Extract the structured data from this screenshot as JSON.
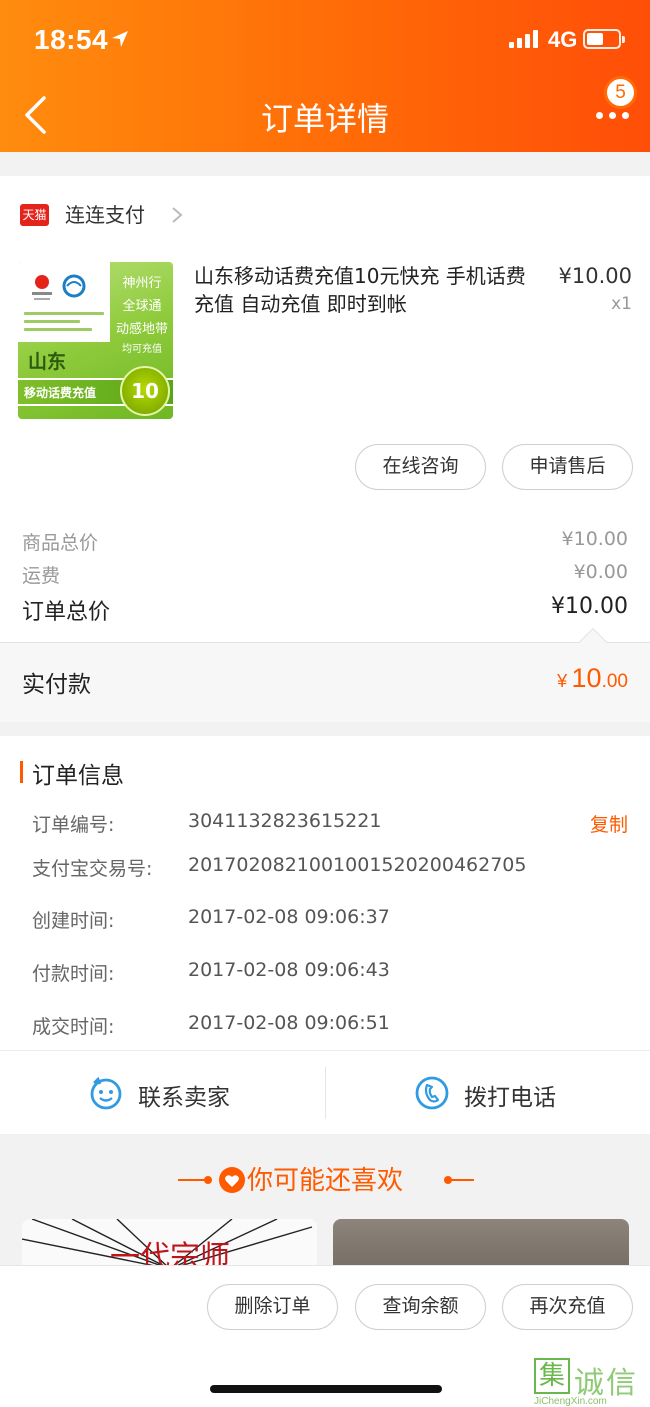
{
  "status_bar": {
    "time": "18:54",
    "network": "4G"
  },
  "nav": {
    "title": "订单详情",
    "badge_count": "5"
  },
  "store": {
    "logo_text": "天猫",
    "name": "连连支付"
  },
  "product": {
    "title": "山东移动话费充值10元快充 手机话费充值 自动充值  即时到帐",
    "price": "¥10.00",
    "quantity": "x1",
    "image": {
      "side_lines": [
        "神州行",
        "全球通",
        "动感地带"
      ],
      "side_small": "均可充值",
      "province": "山东",
      "band_text": "移动话费充值",
      "amount": "10"
    }
  },
  "actions": {
    "consult": "在线咨询",
    "after_sale": "申请售后"
  },
  "summary": {
    "goods_total_label": "商品总价",
    "goods_total_value": "¥10.00",
    "shipping_label": "运费",
    "shipping_value": "¥0.00",
    "order_total_label": "订单总价",
    "order_total_value": "¥10.00"
  },
  "paid": {
    "label": "实付款",
    "currency": "¥",
    "integer": "10",
    "decimal": ".00"
  },
  "order_info": {
    "title": "订单信息",
    "copy_label": "复制",
    "rows": [
      {
        "label": "订单编号:",
        "value": "3041132823615221"
      },
      {
        "label": "支付宝交易号:",
        "value": "2017020821001001520200462705"
      },
      {
        "label": "创建时间:",
        "value": "2017-02-08 09:06:37"
      },
      {
        "label": "付款时间:",
        "value": "2017-02-08 09:06:43"
      },
      {
        "label": "成交时间:",
        "value": "2017-02-08 09:06:51"
      }
    ]
  },
  "contact": {
    "seller_label": "联系卖家",
    "phone_label": "拨打电话"
  },
  "recommend": {
    "title": "你可能还喜欢",
    "card1_text": "一代宗师"
  },
  "bottom_actions": {
    "delete": "删除订单",
    "balance": "查询余额",
    "recharge": "再次充值"
  },
  "watermark": {
    "box_char": "集",
    "text": "诚信",
    "url": "JiChengXin.com"
  },
  "colors": {
    "brand_orange": "#ff5a00",
    "header_start": "#ff8c0e",
    "header_end": "#ff4e08",
    "link_blue": "#2f9be3"
  },
  "icons": [
    "location-arrow-icon",
    "signal-icon",
    "battery-icon",
    "back-arrow-icon",
    "more-icon",
    "chevron-right-icon",
    "chat-face-icon",
    "phone-icon",
    "heart-icon"
  ]
}
